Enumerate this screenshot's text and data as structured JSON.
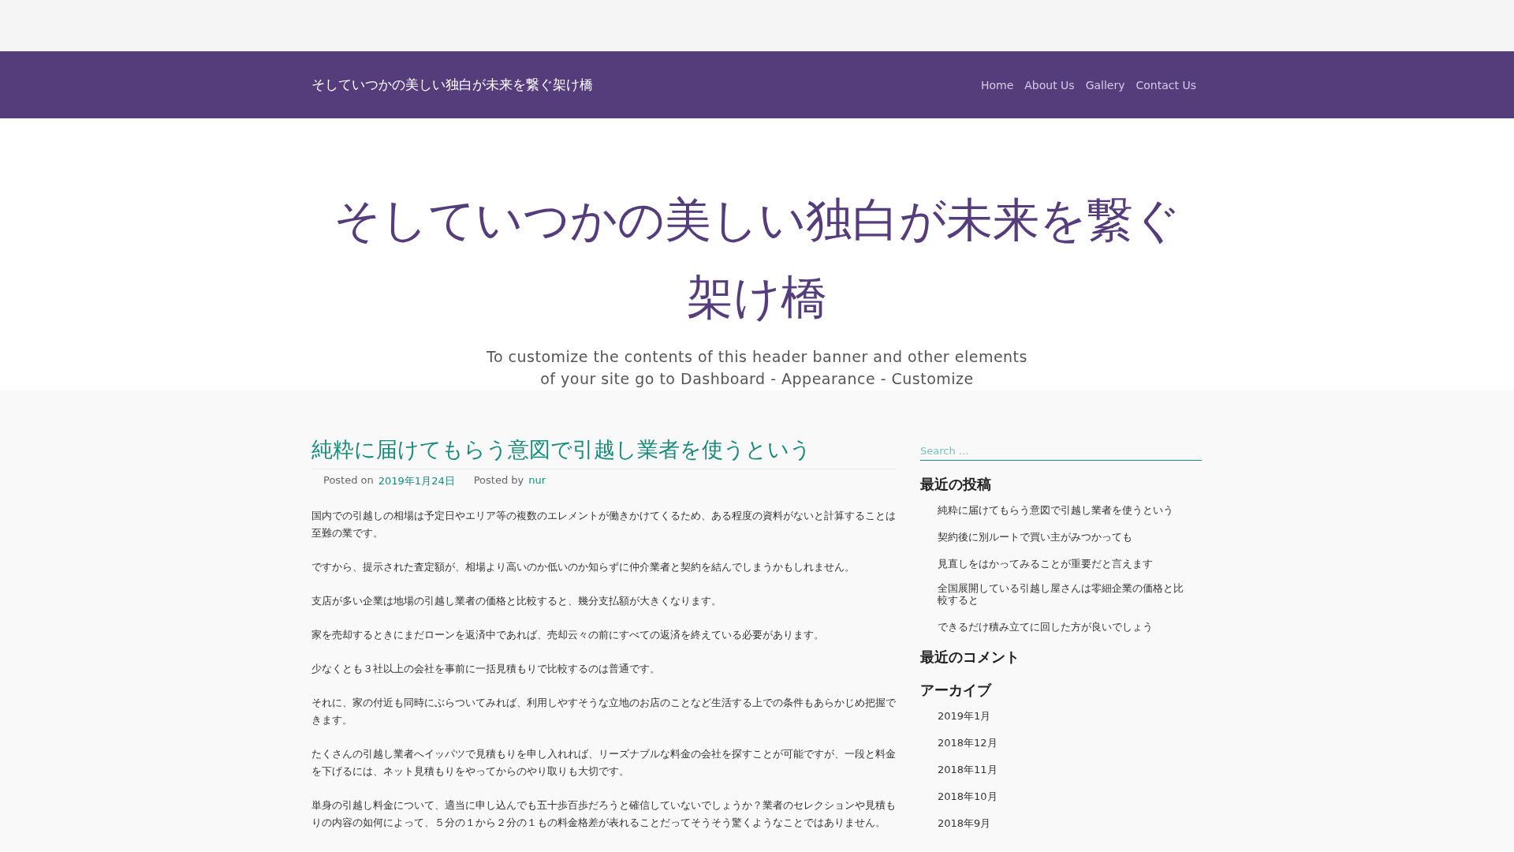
{
  "navbar": {
    "site_title": "そしていつかの美しい独白が未来を繋ぐ架け橋",
    "menu": [
      {
        "label": "Home"
      },
      {
        "label": "About Us"
      },
      {
        "label": "Gallery"
      },
      {
        "label": "Contact Us"
      }
    ]
  },
  "banner": {
    "title": "そしていつかの美しい独白が未来を繋ぐ架け橋",
    "description": "To customize the contents of this header banner and other elements of your site go to Dashboard - Appearance - Customize"
  },
  "post": {
    "title": "純粋に届けてもらう意図で引越し業者を使うという",
    "posted_on_label": "Posted on",
    "date": "2019年1月24日",
    "posted_by_label": "Posted by",
    "author": "nur",
    "paragraphs": [
      "国内での引越しの相場は予定日やエリア等の複数のエレメントが働きかけてくるため、ある程度の資料がないと計算することは至難の業です。",
      "ですから、提示された査定額が、相場より高いのか低いのか知らずに仲介業者と契約を結んでしまうかもしれません。",
      "支店が多い企業は地場の引越し業者の価格と比較すると、幾分支払額が大きくなります。",
      "家を売却するときにまだローンを返済中であれば、売却云々の前にすべての返済を終えている必要があります。",
      "少なくとも３社以上の会社を事前に一括見積もりで比較するのは普通です。",
      "それに、家の付近も同時にぶらついてみれば、利用しやすそうな立地のお店のことなど生活する上での条件もあらかじめ把握できます。",
      "たくさんの引越し業者へイッパツで見積もりを申し入れれば、リーズナブルな料金の会社を探すことが可能ですが、一段と料金を下げるには、ネット見積もりをやってからのやり取りも大切です。",
      "単身の引越し料金について、適当に申し込んでも五十歩百歩だろうと確信していないでしょうか？業者のセレクションや見積もりの内容の如何によって、５分の１から２分の１もの料金格差が表れることだってそうそう驚くようなことではありません。"
    ]
  },
  "sidebar": {
    "search": {
      "placeholder": "Search …"
    },
    "recent_posts": {
      "heading": "最近の投稿",
      "items": [
        "純粋に届けてもらう意図で引越し業者を使うという",
        "契約後に別ルートで買い主がみつかっても",
        "見直しをはかってみることが重要だと言えます",
        "全国展開している引越し屋さんは零細企業の価格と比較すると",
        "できるだけ積み立てに回した方が良いでしょう"
      ]
    },
    "recent_comments": {
      "heading": "最近のコメント"
    },
    "archives": {
      "heading": "アーカイブ",
      "items": [
        "2019年1月",
        "2018年12月",
        "2018年11月",
        "2018年10月",
        "2018年9月"
      ]
    }
  }
}
